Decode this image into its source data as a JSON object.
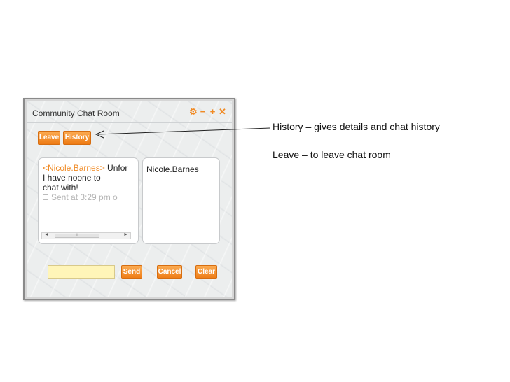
{
  "widget": {
    "title": "Community Chat Room",
    "controls": {
      "settings": "⚙",
      "minimize": "−",
      "maximize": "+",
      "close": "✕"
    },
    "buttons": {
      "leave": "Leave",
      "history": "History",
      "send": "Send",
      "cancel": "Cancel",
      "clear": "Clear"
    },
    "chat": {
      "sender": "<Nicole.Barnes>",
      "message_line1": " Unfor",
      "message_line2": "I have noone to",
      "message_line3": "chat with!",
      "sent_info": "Sent at 3:29 pm o",
      "scroll_thumb": "III"
    },
    "users": [
      "Nicole.Barnes"
    ],
    "input": {
      "value": ""
    }
  },
  "annotations": {
    "history": "History – gives details and chat history",
    "leave": "Leave – to leave chat room"
  },
  "colors": {
    "accent_orange": "#f08a24",
    "input_yellow": "#fff5b8"
  }
}
